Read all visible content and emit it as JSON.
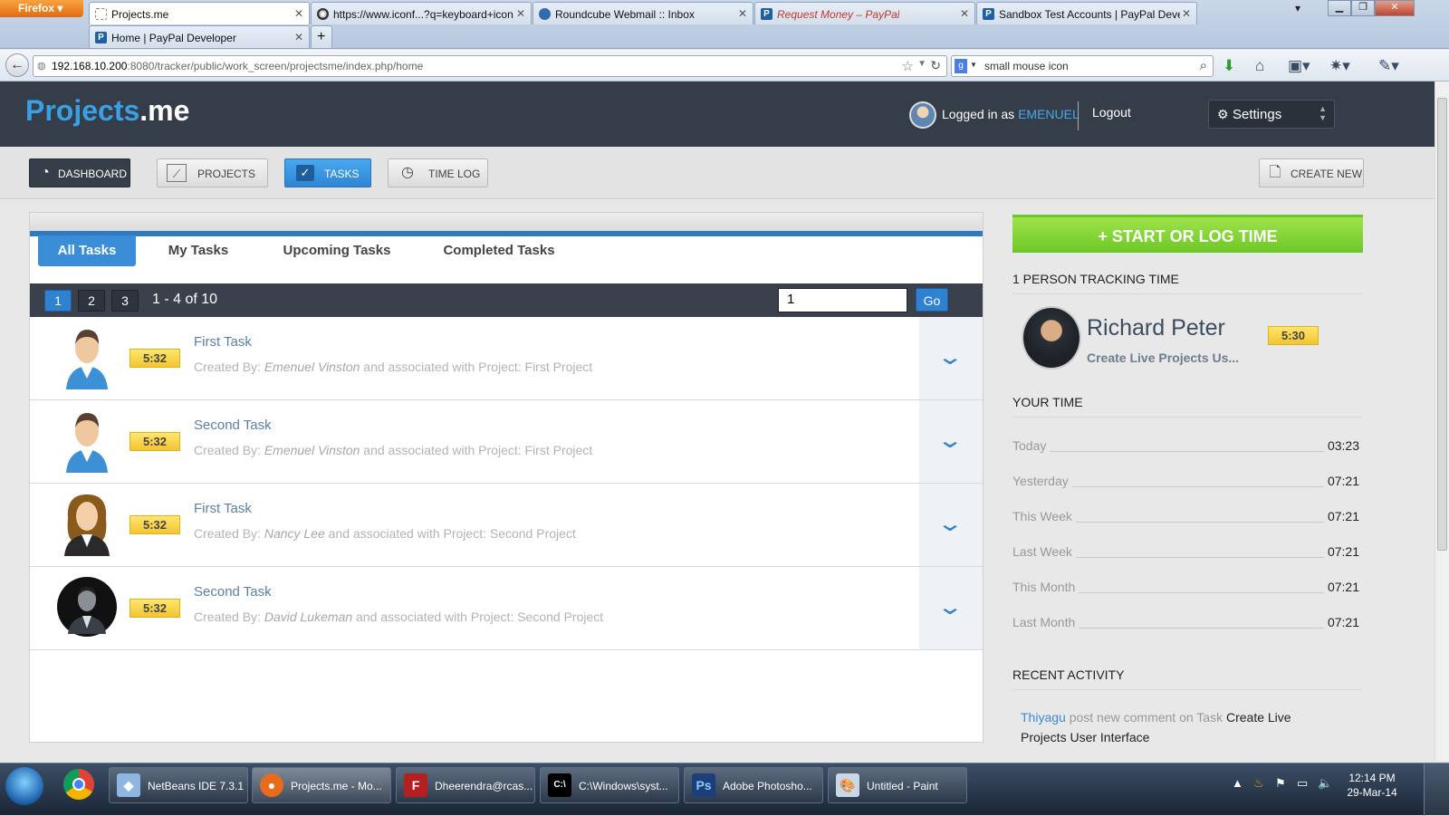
{
  "browser": {
    "firefox_label": "Firefox",
    "tabs_row1": [
      {
        "label": "Projects.me",
        "icon": "page-icon",
        "active": true
      },
      {
        "label": "https://www.iconf...?q=keyboard+icon",
        "icon": "eye-icon"
      },
      {
        "label": "Roundcube Webmail :: Inbox",
        "icon": "roundcube-icon"
      },
      {
        "label": "Request Money – PayPal",
        "icon": "paypal-icon"
      },
      {
        "label": "Sandbox Test Accounts | PayPal Deve...",
        "icon": "paypal-icon"
      }
    ],
    "tabs_row2": [
      {
        "label": "Home | PayPal Developer",
        "icon": "paypal-icon"
      }
    ],
    "new_tab_label": "+",
    "url": "192.168.10.200:8080/tracker/public/work_screen/projectsme/index.php/home",
    "url_host": "192.168.10.200",
    "url_rest": ":8080/tracker/public/work_screen/projectsme/index.php/home",
    "search_value": "small mouse icon"
  },
  "header": {
    "logo_main": "Projects",
    "logo_suffix": ".me",
    "logged_prefix": "Logged in as",
    "username": "EMENUEL",
    "logout_label": "Logout",
    "settings_label": "Settings"
  },
  "toolbar": {
    "dashboard": "DASHBOARD",
    "projects": "PROJECTS",
    "tasks": "TASKS",
    "time_log": "TIME LOG",
    "create_new": "CREATE NEW"
  },
  "tabs": [
    "All Tasks",
    "My Tasks",
    "Upcoming Tasks",
    "Completed Tasks"
  ],
  "pager": {
    "pages": [
      "1",
      "2",
      "3"
    ],
    "info": "1 - 4 of 10",
    "input_value": "1",
    "go_label": "Go"
  },
  "tasks": [
    {
      "title": "First Task",
      "time": "5:32",
      "created_prefix": "Created By: ",
      "creator": "Emenuel Vinston",
      "assoc": " and associated with Project: First Project",
      "avatar": "male-avatar"
    },
    {
      "title": "Second Task",
      "time": "5:32",
      "created_prefix": "Created By: ",
      "creator": "Emenuel Vinston",
      "assoc": " and associated with Project: First Project",
      "avatar": "male-avatar"
    },
    {
      "title": "First Task",
      "time": "5:32",
      "created_prefix": "Created By: ",
      "creator": "Nancy Lee",
      "assoc": " and associated with Project: Second Project",
      "avatar": "female-avatar"
    },
    {
      "title": "Second Task",
      "time": "5:32",
      "created_prefix": "Created By: ",
      "creator": "David Lukeman",
      "assoc": " and associated with Project: Second Project",
      "avatar": "businessman-avatar"
    }
  ],
  "sidebar": {
    "start_button": "+ START OR LOG TIME",
    "tracking_heading": "1 PERSON TRACKING TIME",
    "tracker": {
      "name": "Richard Peter",
      "subtitle": "Create Live Projects Us...",
      "time": "5:30"
    },
    "your_time_heading": "YOUR TIME",
    "your_time": [
      {
        "label": "Today",
        "value": "03:23"
      },
      {
        "label": "Yesterday",
        "value": "07:21"
      },
      {
        "label": "This Week",
        "value": "07:21"
      },
      {
        "label": "Last Week",
        "value": "07:21"
      },
      {
        "label": "This Month",
        "value": "07:21"
      },
      {
        "label": "Last Month",
        "value": "07:21"
      }
    ],
    "recent_heading": "RECENT ACTIVITY",
    "activity": {
      "user": "Thiyagu",
      "text": " post new comment on Task ",
      "task": "Create Live Projects User Interface"
    }
  },
  "taskbar": {
    "items": [
      {
        "label": "NetBeans IDE 7.3.1",
        "icon": "netbeans-icon"
      },
      {
        "label": "Projects.me - Mo...",
        "icon": "firefox-icon"
      },
      {
        "label": "Dheerendra@rcas...",
        "icon": "filezilla-icon"
      },
      {
        "label": "C:\\Windows\\syst...",
        "icon": "cmd-icon"
      },
      {
        "label": "Adobe Photosho...",
        "icon": "photoshop-icon"
      },
      {
        "label": "Untitled - Paint",
        "icon": "paint-icon"
      }
    ],
    "time": "12:14 PM",
    "date": "29-Mar-14"
  },
  "colors": {
    "accent": "#3a8ed8",
    "header_bg": "#353d48",
    "start_green": "#7fd131",
    "badge_yellow": "#f3c531"
  }
}
